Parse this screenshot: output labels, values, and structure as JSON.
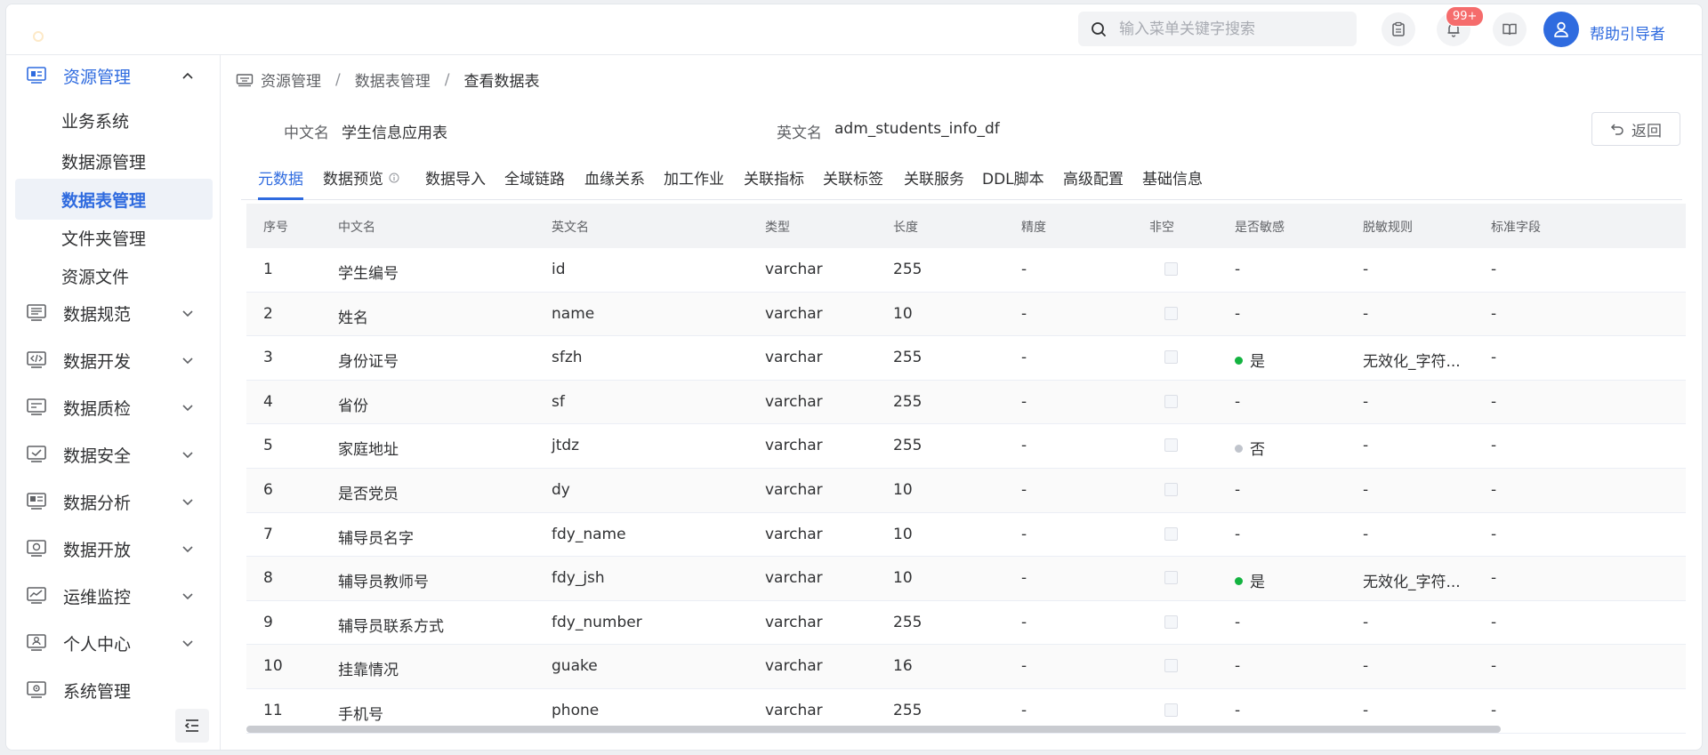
{
  "header": {
    "search_placeholder": "输入菜单关键字搜索",
    "notification_badge": "99+",
    "username": "帮助引导者"
  },
  "sidebar": {
    "group_open": "资源管理",
    "sub_items": [
      "业务系统",
      "数据源管理",
      "数据表管理",
      "文件夹管理",
      "资源文件"
    ],
    "active_sub_item": "数据表管理",
    "groups": [
      "数据规范",
      "数据开发",
      "数据质检",
      "数据安全",
      "数据分析",
      "数据开放",
      "运维监控",
      "个人中心",
      "系统管理"
    ]
  },
  "breadcrumb": [
    "资源管理",
    "数据表管理",
    "查看数据表"
  ],
  "table_info": {
    "cn_label": "中文名",
    "cn_value": "学生信息应用表",
    "en_label": "英文名",
    "en_value": "adm_students_info_df",
    "back_label": "返回"
  },
  "tabs": [
    "元数据",
    "数据预览",
    "数据导入",
    "全域链路",
    "血缘关系",
    "加工作业",
    "关联指标",
    "关联标签",
    "关联服务",
    "DDL脚本",
    "高级配置",
    "基础信息"
  ],
  "active_tab": "元数据",
  "columns": [
    "序号",
    "中文名",
    "英文名",
    "类型",
    "长度",
    "精度",
    "非空",
    "是否敏感",
    "脱敏规则",
    "标准字段"
  ],
  "rows": [
    {
      "no": "1",
      "cn": "学生编号",
      "en": "id",
      "type": "varchar",
      "len": "255",
      "prec": "-",
      "sens": "-",
      "rule": "-",
      "std": "-"
    },
    {
      "no": "2",
      "cn": "姓名",
      "en": "name",
      "type": "varchar",
      "len": "10",
      "prec": "-",
      "sens": "-",
      "rule": "-",
      "std": "-"
    },
    {
      "no": "3",
      "cn": "身份证号",
      "en": "sfzh",
      "type": "varchar",
      "len": "255",
      "prec": "-",
      "sens": "是",
      "sens_color": "#13b340",
      "rule": "无效化_字符...",
      "std": "-"
    },
    {
      "no": "4",
      "cn": "省份",
      "en": "sf",
      "type": "varchar",
      "len": "255",
      "prec": "-",
      "sens": "-",
      "rule": "-",
      "std": "-"
    },
    {
      "no": "5",
      "cn": "家庭地址",
      "en": "jtdz",
      "type": "varchar",
      "len": "255",
      "prec": "-",
      "sens": "否",
      "sens_color": "#c0c4cc",
      "rule": "-",
      "std": "-"
    },
    {
      "no": "6",
      "cn": "是否党员",
      "en": "dy",
      "type": "varchar",
      "len": "10",
      "prec": "-",
      "sens": "-",
      "rule": "-",
      "std": "-"
    },
    {
      "no": "7",
      "cn": "辅导员名字",
      "en": "fdy_name",
      "type": "varchar",
      "len": "10",
      "prec": "-",
      "sens": "-",
      "rule": "-",
      "std": "-"
    },
    {
      "no": "8",
      "cn": "辅导员教师号",
      "en": "fdy_jsh",
      "type": "varchar",
      "len": "10",
      "prec": "-",
      "sens": "是",
      "sens_color": "#13b340",
      "rule": "无效化_字符...",
      "std": "-"
    },
    {
      "no": "9",
      "cn": "辅导员联系方式",
      "en": "fdy_number",
      "type": "varchar",
      "len": "255",
      "prec": "-",
      "sens": "-",
      "rule": "-",
      "std": "-"
    },
    {
      "no": "10",
      "cn": "挂靠情况",
      "en": "guake",
      "type": "varchar",
      "len": "16",
      "prec": "-",
      "sens": "-",
      "rule": "-",
      "std": "-"
    },
    {
      "no": "11",
      "cn": "手机号",
      "en": "phone",
      "type": "varchar",
      "len": "255",
      "prec": "-",
      "sens": "-",
      "rule": "-",
      "std": "-"
    }
  ]
}
